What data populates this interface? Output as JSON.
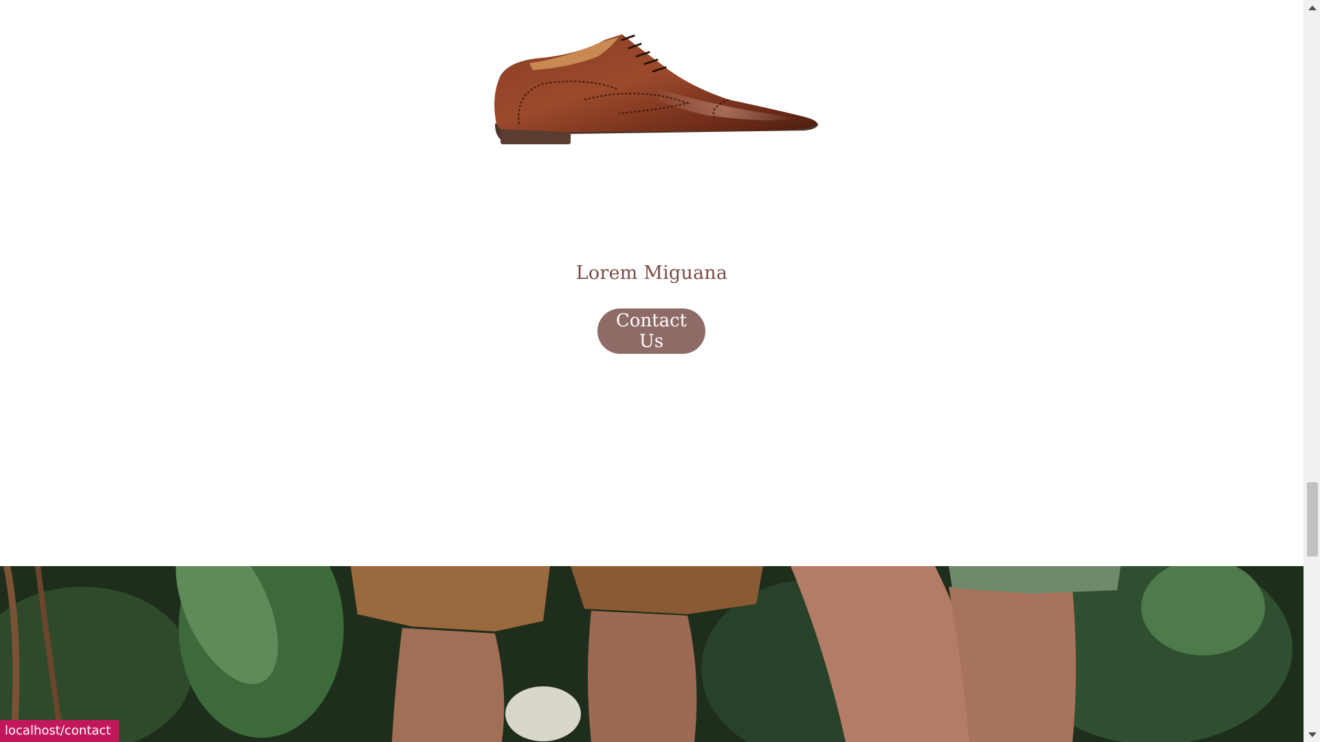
{
  "product": {
    "name": "Lorem Miguana",
    "image_alt": "brown-leather-oxford-shoe"
  },
  "cta": {
    "contact_label": "Contact Us"
  },
  "hero": {
    "image_alt": "legs-in-shorts-jungle-plants"
  },
  "status_bar": {
    "url": "localhost/contact"
  },
  "colors": {
    "product_name": "#7a4a47",
    "button_bg": "#8f6b68",
    "status_bar_bg": "#c2185b"
  }
}
